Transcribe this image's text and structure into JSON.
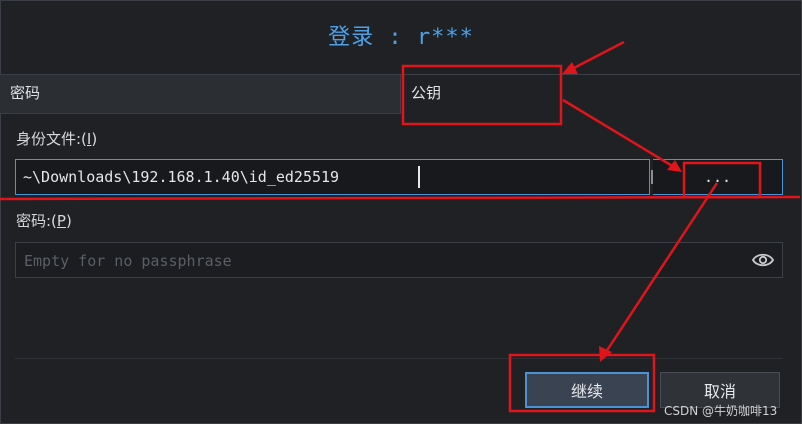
{
  "dialog": {
    "title": "登录 : r***"
  },
  "tabs": [
    {
      "label": "密码"
    },
    {
      "label": "公钥"
    }
  ],
  "identity": {
    "label_prefix": "身份文件:(",
    "label_mnemonic": "I",
    "label_suffix": ")",
    "value": "~\\Downloads\\192.168.1.40\\id_ed25519",
    "browse_label": "..."
  },
  "passphrase": {
    "label_prefix": "密码:(",
    "label_mnemonic": "P",
    "label_suffix": ")",
    "placeholder": "Empty for no passphrase",
    "reveal_icon": "eye-icon"
  },
  "buttons": {
    "continue": "继续",
    "cancel": "取消"
  },
  "watermark": "CSDN @牛奶咖啡13",
  "colors": {
    "accent": "#4ea1e6",
    "annotation": "#e0141b"
  }
}
